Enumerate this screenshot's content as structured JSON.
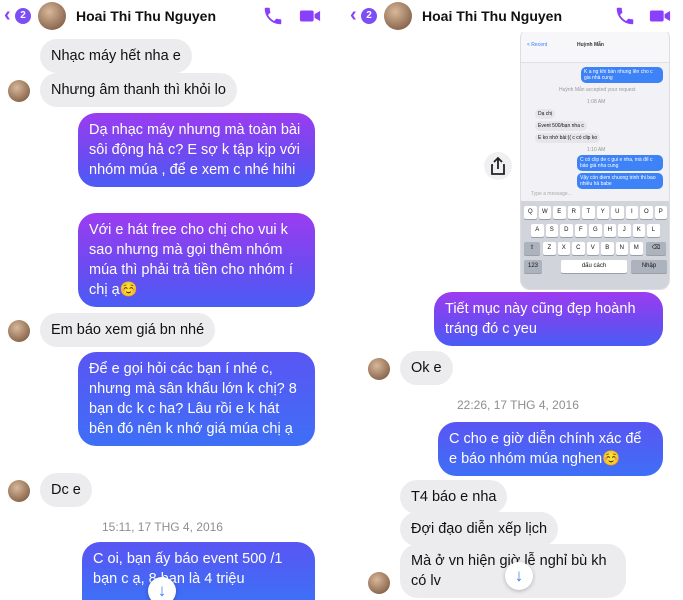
{
  "left": {
    "header": {
      "back_badge": "2",
      "name": "Hoai Thi Thu Nguyen"
    },
    "messages": [
      {
        "text": "Nhạc máy hết nha e"
      },
      {
        "text": "Nhưng âm thanh thì khỏi lo"
      },
      {
        "text": "Dạ nhạc máy nhưng mà toàn bài sôi động hả c? E sợ k tập kịp với nhóm múa , để e xem c nhé hihi"
      },
      {
        "text": "Với e hát free cho chị cho vui k sao nhưng mà gọi thêm nhóm múa thì phải trả tiền cho nhóm í chị ạ☺️"
      },
      {
        "text": "Em báo xem giá bn nhé"
      },
      {
        "text": "Để e gọi hỏi các bạn í nhé c, nhưng mà sân khấu lớn k chị? 8 bạn dc k c ha? Lâu rồi e k hát bên đó nên k nhớ giá múa chị ạ"
      },
      {
        "text": "Dc e"
      },
      {
        "text": "C oi, bạn ấy báo event 500 /1 bạn c ạ, 8 bạn là 4 triệu"
      }
    ],
    "timestamp": "15:11, 17 THG 4, 2016"
  },
  "right": {
    "header": {
      "back_badge": "2",
      "name": "Hoai Thi Thu Nguyen"
    },
    "screenshot": {
      "back": "< Recent",
      "contact": "Huỳnh Mẫn",
      "msg_top": "K a ng khi bán nhung lên cho c gia nhà cung",
      "accepted": "Huỳnh Mẫn accepted your request",
      "time1": "1:08 AM",
      "msg_a": "Dạ chị",
      "msg_b": "Event 500/bạn nha c",
      "msg_c": "E ko nhớ bài:(( c có clip ko",
      "time2": "1:10 AM",
      "msg_d": "C có clip de c gui e nha, mà để c báo giá nha cung",
      "msg_e": "Vậy còn diem chuong trinh thi bao nhiêu hả babe",
      "input_placeholder": "Type a message...",
      "keys_row1": [
        "Q",
        "W",
        "E",
        "R",
        "T",
        "Y",
        "U",
        "I",
        "O",
        "P"
      ],
      "keys_row2": [
        "A",
        "S",
        "D",
        "F",
        "G",
        "H",
        "J",
        "K",
        "L"
      ],
      "keys_row3": [
        "Z",
        "X",
        "C",
        "V",
        "B",
        "N",
        "M"
      ],
      "key_123": "123",
      "key_space": "dấu cách",
      "key_return": "Nhập"
    },
    "messages": [
      {
        "text": "Tiết mục này cũng đẹp hoành tráng đó c yeu"
      },
      {
        "text": "Ok e"
      },
      {
        "text": "C cho e giờ diễn chính xác để e báo nhóm múa nghen☺️"
      },
      {
        "text": "T4 báo e nha"
      },
      {
        "text": "Đợi đạo diễn xếp lịch"
      },
      {
        "text": "Mà ở vn hiện giờ lễ nghỉ bù kh có lv"
      }
    ],
    "timestamp": "22:26, 17 THG 4, 2016"
  },
  "colors": {
    "accent": "#8a3ffc",
    "incoming": "#ececee",
    "outgoing_top": "#9c3cf1",
    "outgoing_bottom": "#3e6ff6",
    "timestamp": "#8e8e93"
  },
  "icons": [
    "back-chevron-icon",
    "phone-icon",
    "video-call-icon",
    "share-icon",
    "scroll-down-arrow-icon"
  ]
}
